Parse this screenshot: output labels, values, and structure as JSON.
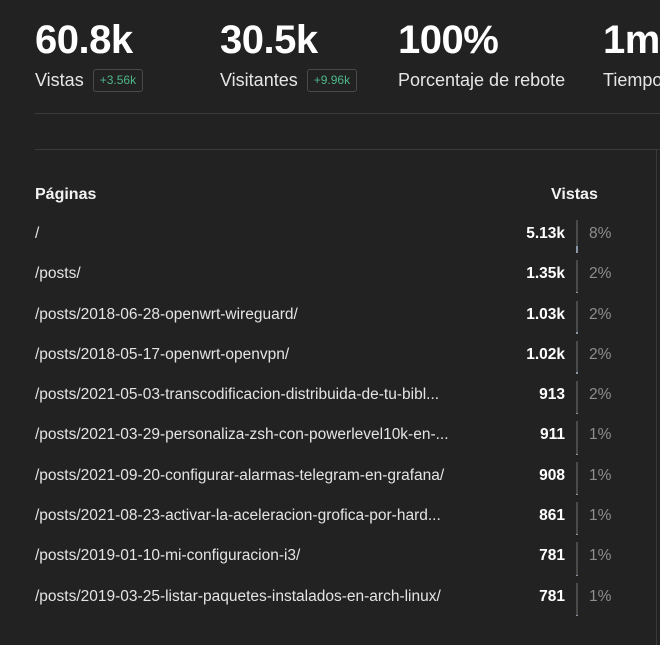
{
  "metrics": [
    {
      "value": "60.8k",
      "label": "Vistas",
      "change": "+3.56k"
    },
    {
      "value": "30.5k",
      "label": "Visitantes",
      "change": "+9.96k"
    },
    {
      "value": "100%",
      "label": "Porcentaje de rebote"
    },
    {
      "value": "1m",
      "label": "Tiempo"
    }
  ],
  "table": {
    "header_pages": "Páginas",
    "header_views": "Vistas",
    "rows": [
      {
        "path": "/",
        "views": "5.13k",
        "pct": "8%",
        "share": 0.08
      },
      {
        "path": "/posts/",
        "views": "1.35k",
        "pct": "2%",
        "share": 0.02
      },
      {
        "path": "/posts/2018-06-28-openwrt-wireguard/",
        "views": "1.03k",
        "pct": "2%",
        "share": 0.02
      },
      {
        "path": "/posts/2018-05-17-openwrt-openvpn/",
        "views": "1.02k",
        "pct": "2%",
        "share": 0.02
      },
      {
        "path": "/posts/2021-05-03-transcodificacion-distribuida-de-tu-bibl...",
        "views": "913",
        "pct": "2%",
        "share": 0.02
      },
      {
        "path": "/posts/2021-03-29-personaliza-zsh-con-powerlevel10k-en-...",
        "views": "911",
        "pct": "1%",
        "share": 0.01
      },
      {
        "path": "/posts/2021-09-20-configurar-alarmas-telegram-en-grafana/",
        "views": "908",
        "pct": "1%",
        "share": 0.01
      },
      {
        "path": "/posts/2021-08-23-activar-la-aceleracion-grofica-por-hard...",
        "views": "861",
        "pct": "1%",
        "share": 0.01
      },
      {
        "path": "/posts/2019-01-10-mi-configuracion-i3/",
        "views": "781",
        "pct": "1%",
        "share": 0.01
      },
      {
        "path": "/posts/2019-03-25-listar-paquetes-instalados-en-arch-linux/",
        "views": "781",
        "pct": "1%",
        "share": 0.01
      }
    ]
  },
  "colors": {
    "background": "#222222",
    "change_green": "#4fb58a",
    "bar_fill": "#8a95a8"
  }
}
